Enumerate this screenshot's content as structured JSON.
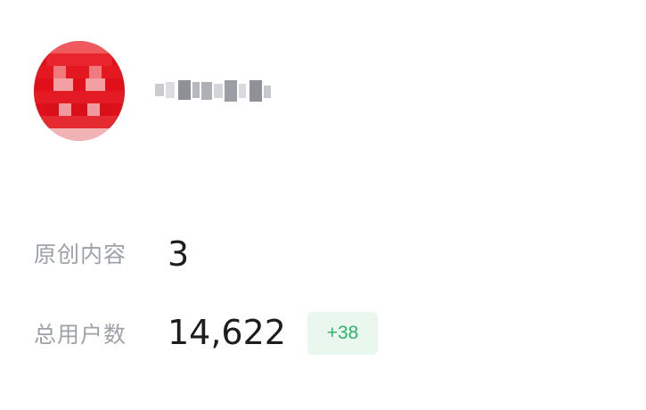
{
  "profile": {
    "avatar_icon": "avatar-icon",
    "name_obscured": true
  },
  "stats": {
    "original_content": {
      "label": "原创内容",
      "value": "3"
    },
    "total_users": {
      "label": "总用户数",
      "value": "14,622",
      "delta": "+38"
    }
  },
  "colors": {
    "label_gray": "#9ea1a8",
    "value_black": "#1d1d1f",
    "badge_bg": "#e9f7ee",
    "badge_text": "#2fb36b",
    "avatar_red": "#e0101a"
  }
}
